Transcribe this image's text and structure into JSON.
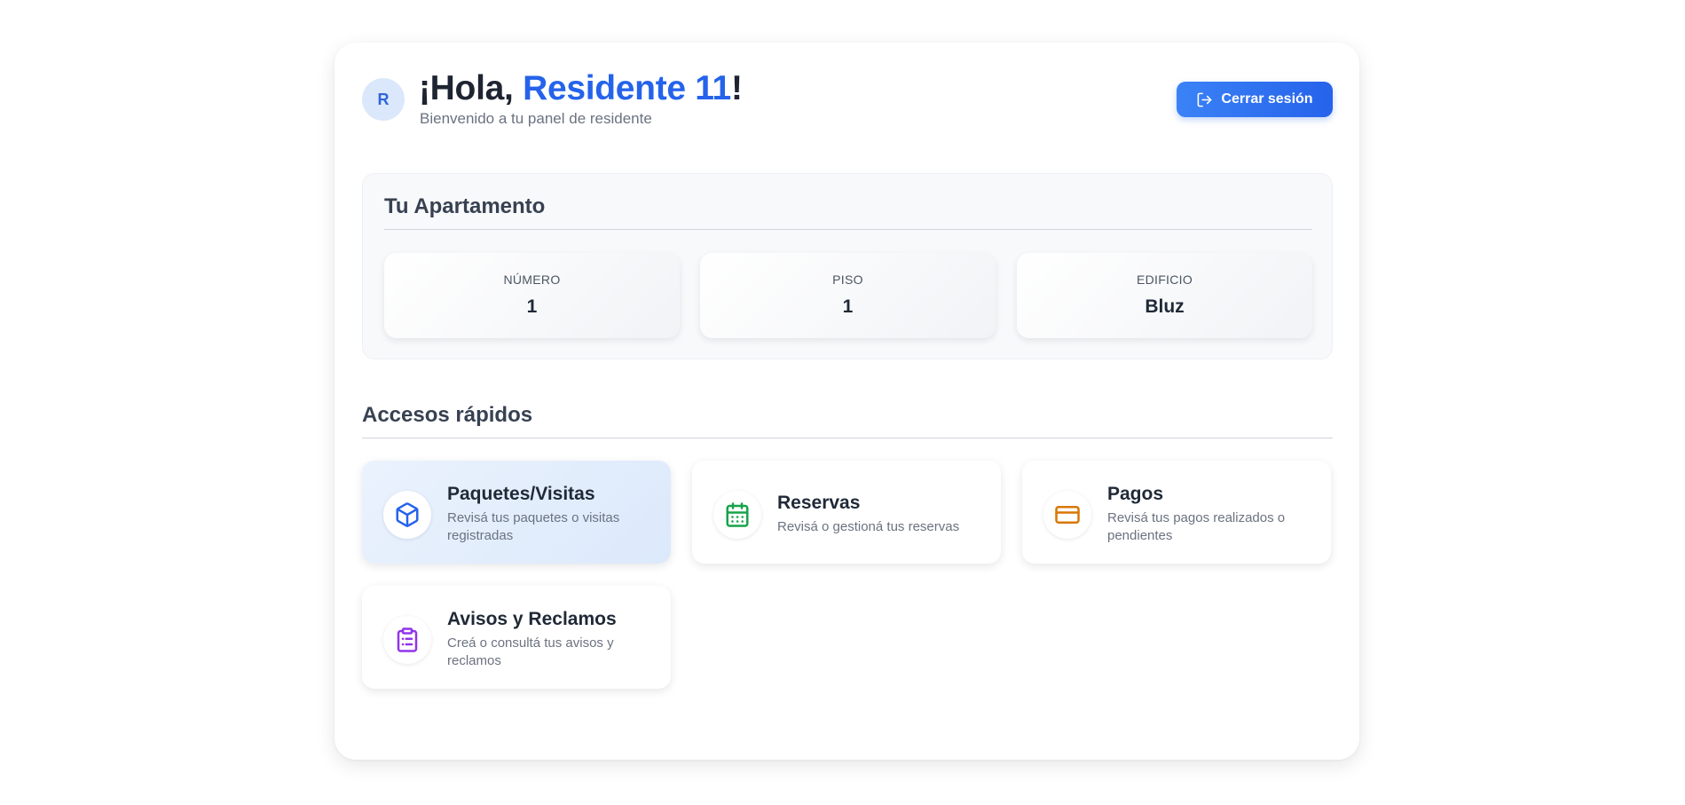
{
  "header": {
    "avatar_initial": "R",
    "greeting_prefix": "¡Hola, ",
    "resident_name": "Residente 11",
    "greeting_suffix": "!",
    "subtitle": "Bienvenido a tu panel de residente",
    "logout_label": "Cerrar sesión"
  },
  "apartment": {
    "title": "Tu Apartamento",
    "stats": [
      {
        "label": "NÚMERO",
        "value": "1"
      },
      {
        "label": "PISO",
        "value": "1"
      },
      {
        "label": "EDIFICIO",
        "value": "Bluz"
      }
    ]
  },
  "quick_access": {
    "title": "Accesos rápidos",
    "items": [
      {
        "title": "Paquetes/Visitas",
        "description": "Revisá tus paquetes o visitas registradas",
        "icon": "package-icon",
        "color": "#2563eb",
        "active": true
      },
      {
        "title": "Reservas",
        "description": "Revisá o gestioná tus reservas",
        "icon": "calendar-icon",
        "color": "#16a34a",
        "active": false
      },
      {
        "title": "Pagos",
        "description": "Revisá tus pagos realizados o pendientes",
        "icon": "credit-card-icon",
        "color": "#d97706",
        "active": false
      },
      {
        "title": "Avisos y Reclamos",
        "description": "Creá o consultá tus avisos y reclamos",
        "icon": "clipboard-list-icon",
        "color": "#9333ea",
        "active": false
      }
    ]
  },
  "colors": {
    "accent": "#2563eb",
    "page_background": "#ffffff"
  }
}
